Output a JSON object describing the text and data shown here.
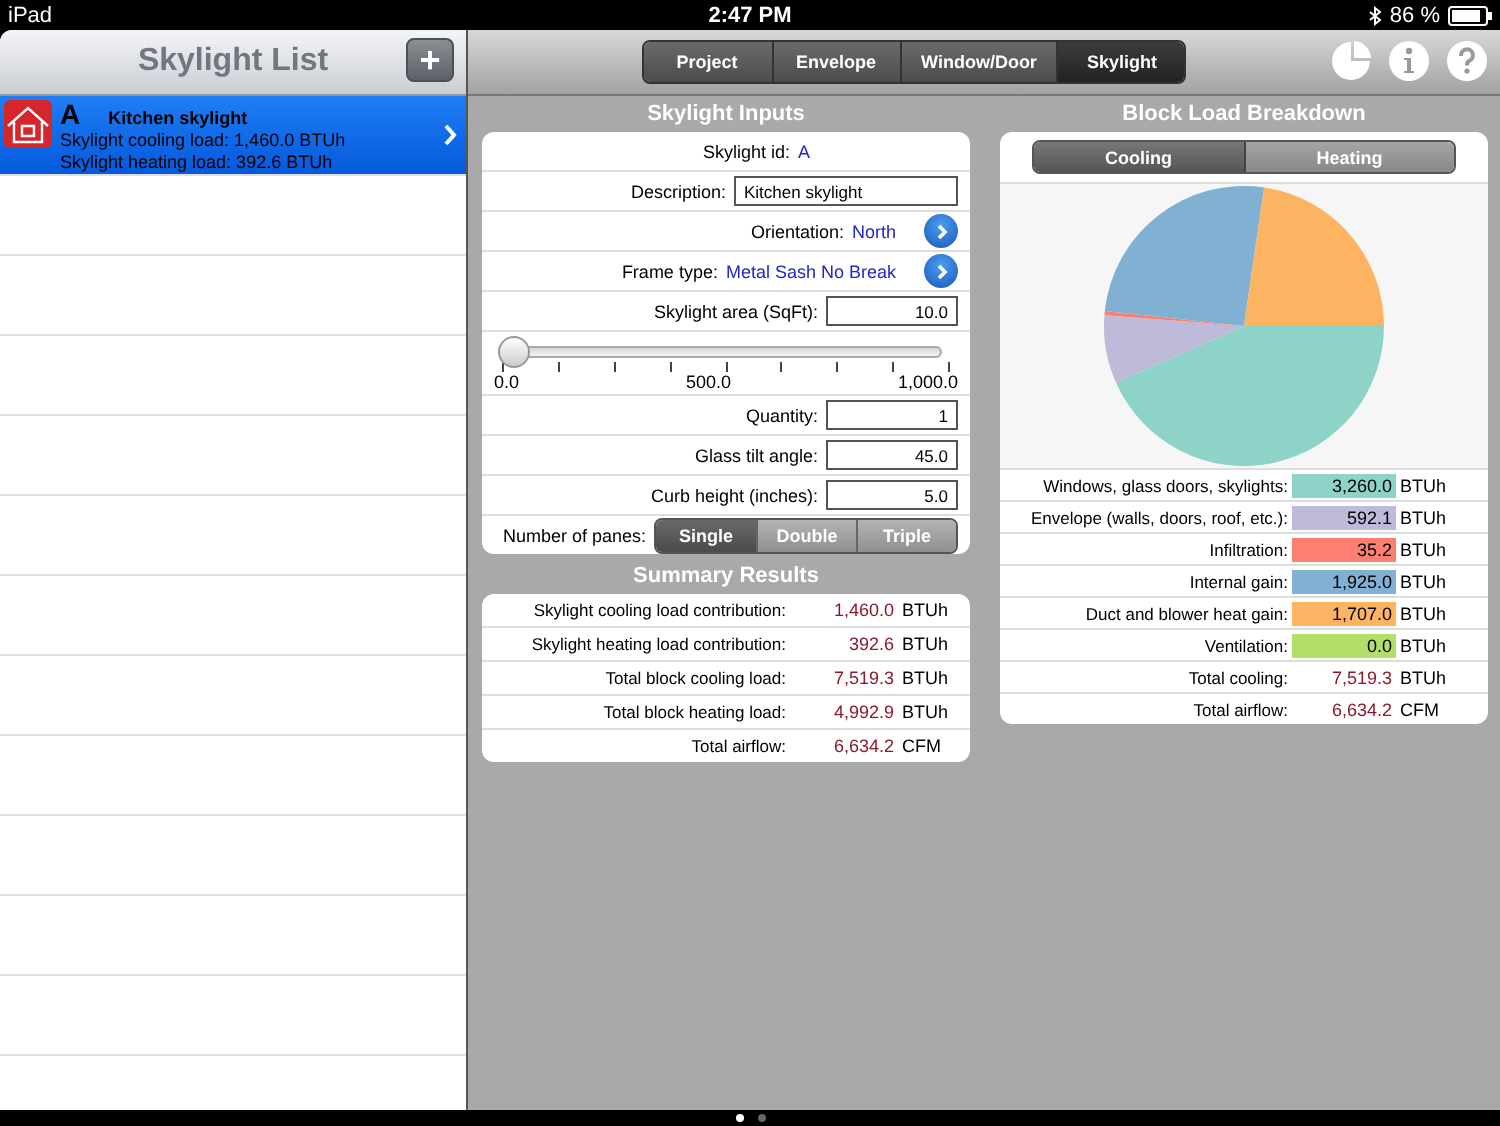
{
  "status_bar": {
    "device": "iPad",
    "time": "2:47 PM",
    "battery": "86 %"
  },
  "sidebar": {
    "title": "Skylight List",
    "add_button": "+",
    "items": [
      {
        "id": "A",
        "name": "Kitchen skylight",
        "lines": [
          "Skylight cooling load: 1,460.0 BTUh",
          "Skylight heating load: 392.6 BTUh"
        ],
        "selected": true
      }
    ]
  },
  "tabs": [
    {
      "label": "Project",
      "selected": false
    },
    {
      "label": "Envelope",
      "selected": false
    },
    {
      "label": "Window/Door",
      "selected": false
    },
    {
      "label": "Skylight",
      "selected": true
    }
  ],
  "inputs": {
    "title": "Skylight Inputs",
    "rows": [
      {
        "kind": "id",
        "label": "Skylight id:",
        "value": "A"
      },
      {
        "kind": "text",
        "label": "Description:",
        "value": "Kitchen skylight"
      },
      {
        "kind": "picker",
        "label": "Orientation:",
        "value": "North"
      },
      {
        "kind": "picker",
        "label": "Frame type:",
        "value": "Metal Sash No Break"
      },
      {
        "kind": "number",
        "label": "Skylight area (SqFt):",
        "value": "10.0"
      },
      {
        "kind": "slider",
        "level": 0.01,
        "min_label": "0.0",
        "mid_label": "500.0",
        "max_label": "1,000.0"
      },
      {
        "kind": "number",
        "label": "Quantity:",
        "value": "1"
      },
      {
        "kind": "number",
        "label": "Glass tilt angle:",
        "value": "45.0"
      },
      {
        "kind": "number",
        "label": "Curb height (inches):",
        "value": "5.0"
      },
      {
        "kind": "segmented",
        "label": "Number of panes:",
        "options": [
          {
            "label": "Single",
            "selected": true
          },
          {
            "label": "Double",
            "selected": false
          },
          {
            "label": "Triple",
            "selected": false
          }
        ]
      }
    ]
  },
  "summary": {
    "title": "Summary Results",
    "rows": [
      {
        "label": "Skylight cooling load contribution:",
        "value": "1,460.0",
        "unit": "BTUh"
      },
      {
        "label": "Skylight heating load contribution:",
        "value": "392.6",
        "unit": "BTUh"
      },
      {
        "label": "Total block cooling load:",
        "value": "7,519.3",
        "unit": "BTUh"
      },
      {
        "label": "Total block heating load:",
        "value": "4,992.9",
        "unit": "BTUh"
      },
      {
        "label": "Total airflow:",
        "value": "6,634.2",
        "unit": "CFM"
      }
    ]
  },
  "breakdown": {
    "title": "Block Load Breakdown",
    "tabs": [
      {
        "label": "Cooling",
        "selected": true
      },
      {
        "label": "Heating",
        "selected": false
      }
    ],
    "chart_data": {
      "type": "pie",
      "values": [
        43.36,
        7.87,
        0.47,
        25.6,
        22.7,
        0.0
      ]
    },
    "rows": [
      {
        "kind": "legend",
        "label": "Windows, glass doors, skylights:",
        "value": "3,260.0",
        "unit": "BTUh",
        "color": "#8dd3c7"
      },
      {
        "kind": "legend",
        "label": "Envelope (walls, doors, roof, etc.):",
        "value": "592.1",
        "unit": "BTUh",
        "color": "#bebada"
      },
      {
        "kind": "legend",
        "label": "Infiltration:",
        "value": "35.2",
        "unit": "BTUh",
        "color": "#fb8072"
      },
      {
        "kind": "legend",
        "label": "Internal gain:",
        "value": "1,925.0",
        "unit": "BTUh",
        "color": "#80b1d3"
      },
      {
        "kind": "legend",
        "label": "Duct and blower heat gain:",
        "value": "1,707.0",
        "unit": "BTUh",
        "color": "#fdb462"
      },
      {
        "kind": "legend",
        "label": "Ventilation:",
        "value": "0.0",
        "unit": "BTUh",
        "color": "#b3de69"
      },
      {
        "kind": "total",
        "label": "Total cooling:",
        "value": "7,519.3",
        "unit": "BTUh"
      },
      {
        "kind": "total",
        "label": "Total airflow:",
        "value": "6,634.2",
        "unit": "CFM"
      }
    ]
  },
  "page_dots": [
    {
      "selected": true
    },
    {
      "selected": false
    }
  ]
}
